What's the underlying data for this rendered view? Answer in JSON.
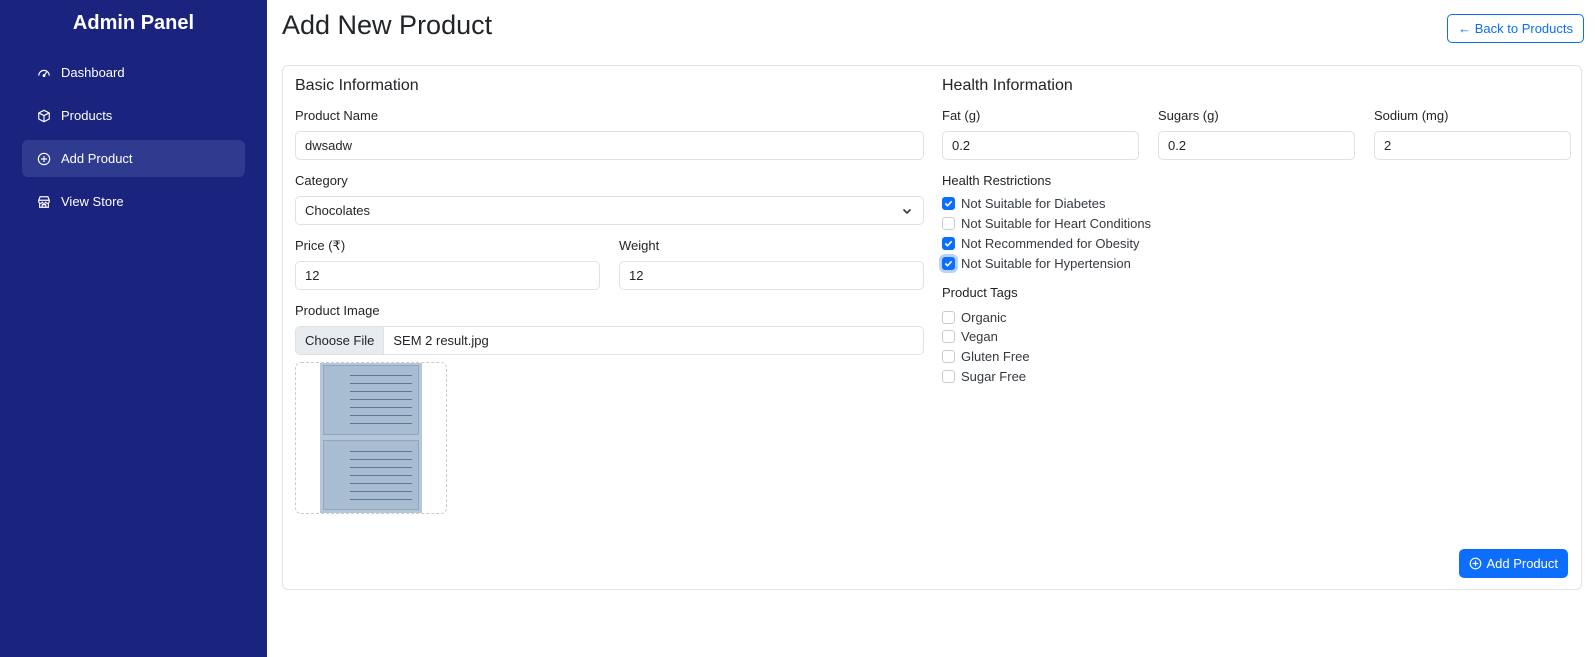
{
  "sidebar": {
    "brand": "Admin Panel",
    "items": [
      {
        "label": "Dashboard",
        "icon": "speedometer-icon"
      },
      {
        "label": "Products",
        "icon": "box-icon"
      },
      {
        "label": "Add Product",
        "icon": "plus-circle-icon",
        "active": true
      },
      {
        "label": "View Store",
        "icon": "shop-icon"
      }
    ]
  },
  "header": {
    "title": "Add New Product",
    "back_button": "← Back to Products"
  },
  "basic": {
    "title": "Basic Information",
    "product_name_label": "Product Name",
    "product_name_value": "dwsadw",
    "category_label": "Category",
    "category_value": "Chocolates",
    "price_label": "Price (₹)",
    "price_value": "12",
    "weight_label": "Weight",
    "weight_value": "12",
    "image_label": "Product Image",
    "file_button": "Choose File",
    "file_name": "SEM 2 result.jpg"
  },
  "health": {
    "title": "Health Information",
    "fat_label": "Fat (g)",
    "fat_value": "0.2",
    "sugars_label": "Sugars (g)",
    "sugars_value": "0.2",
    "sodium_label": "Sodium (mg)",
    "sodium_value": "2",
    "restrictions_label": "Health Restrictions",
    "restrictions": [
      {
        "label": "Not Suitable for Diabetes",
        "checked": true
      },
      {
        "label": "Not Suitable for Heart Conditions",
        "checked": false
      },
      {
        "label": "Not Recommended for Obesity",
        "checked": true
      },
      {
        "label": "Not Suitable for Hypertension",
        "checked": true
      }
    ],
    "tags_label": "Product Tags",
    "tags": [
      {
        "label": "Organic",
        "checked": false
      },
      {
        "label": "Vegan",
        "checked": false
      },
      {
        "label": "Gluten Free",
        "checked": false
      },
      {
        "label": "Sugar Free",
        "checked": false
      }
    ]
  },
  "actions": {
    "add_button": "Add Product"
  },
  "colors": {
    "sidebar_bg": "#1a237e",
    "primary": "#0d6efd"
  }
}
